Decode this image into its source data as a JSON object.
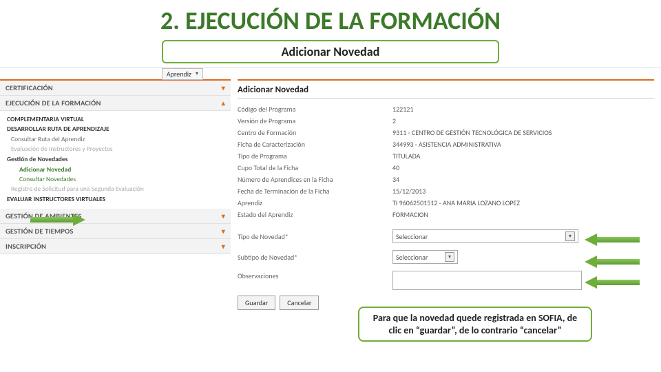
{
  "slide": {
    "title": "2. EJECUCIÓN DE LA FORMACIÓN",
    "subtitle": "Adicionar Novedad",
    "callout": "Para que la novedad quede registrada en SOFIA, de clic en “guardar”, de lo contrario “cancelar”"
  },
  "topbar": {
    "role_select": "Aprendiz"
  },
  "sidebar": {
    "items": [
      {
        "label": "CERTIFICACIÓN",
        "open": false
      },
      {
        "label": "EJECUCIÓN DE LA FORMACIÓN",
        "open": true
      }
    ],
    "open_section": {
      "header1": "COMPLEMENTARIA VIRTUAL",
      "header2": "DESARROLLAR RUTA DE APRENDIZAJE",
      "links": [
        {
          "label": "Consultar Ruta del Aprendiz"
        },
        {
          "label": "Evaluación de Instructores y Proyectos"
        }
      ],
      "header3": "Gestión de Novedades",
      "nested": [
        {
          "label": "Adicionar Novedad",
          "active": true
        },
        {
          "label": "Consultar Novedades"
        }
      ],
      "link_sec_eval": "Registro de Solicitud para una Segunda Evaluación",
      "header4": "EVALUAR INSTRUCTORES VIRTUALES"
    },
    "items_after": [
      {
        "label": "GESTIÓN DE AMBIENTES"
      },
      {
        "label": "GESTIÓN DE TIEMPOS"
      },
      {
        "label": "INSCRIPCIÓN"
      }
    ]
  },
  "content": {
    "title": "Adicionar Novedad",
    "fields": [
      {
        "label": "Código del Programa",
        "value": "122121"
      },
      {
        "label": "Versión de Programa",
        "value": "2"
      },
      {
        "label": "Centro de Formación",
        "value": "9311 - CENTRO DE GESTIÓN TECNOLÓGICA DE SERVICIOS"
      },
      {
        "label": "Ficha de Caracterización",
        "value": "344993 - ASISTENCIA ADMINISTRATIVA"
      },
      {
        "label": "Tipo de Programa",
        "value": "TITULADA"
      },
      {
        "label": "Cupo Total de la Ficha",
        "value": "40"
      },
      {
        "label": "Número de Aprendices en la Ficha",
        "value": "34"
      },
      {
        "label": "Fecha de Terminación de la Ficha",
        "value": "15/12/2013"
      },
      {
        "label": "Aprendiz",
        "value": "TI 96062501512 - ANA MARIA LOZANO LOPEZ"
      },
      {
        "label": "Estado del Aprendiz",
        "value": "FORMACION"
      }
    ],
    "select_tipo": {
      "label": "Tipo de Novedad*",
      "placeholder": "Seleccionar"
    },
    "select_subtipo": {
      "label": "Subtipo de Novedad*",
      "placeholder": "Seleccionar"
    },
    "observaciones_label": "Observaciones",
    "buttons": {
      "save": "Guardar",
      "cancel": "Cancelar"
    }
  }
}
